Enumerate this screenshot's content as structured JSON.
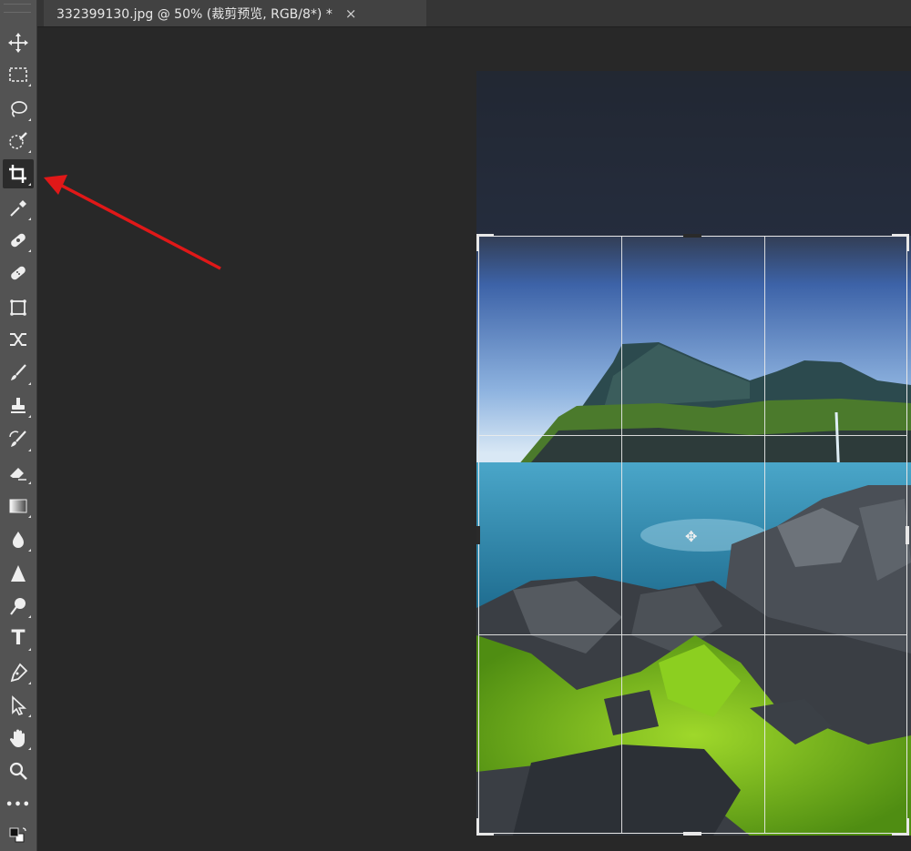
{
  "document_tab": {
    "title": "332399130.jpg @ 50% (裁剪预览, RGB/8*) *",
    "close_glyph": "×"
  },
  "toolbar": {
    "tools": [
      {
        "name": "move-tool",
        "icon": "move-icon",
        "active": false
      },
      {
        "name": "marquee-tool",
        "icon": "rectangular-marquee-icon",
        "active": false
      },
      {
        "name": "lasso-tool",
        "icon": "lasso-icon",
        "active": false
      },
      {
        "name": "quick-selection-tool",
        "icon": "quick-selection-icon",
        "active": false
      },
      {
        "name": "crop-tool",
        "icon": "crop-icon",
        "active": true
      },
      {
        "name": "eyedropper-tool",
        "icon": "eyedropper-icon",
        "active": false
      },
      {
        "name": "spot-healing-tool",
        "icon": "spot-healing-icon",
        "active": false
      },
      {
        "name": "healing-brush-tool",
        "icon": "bandage-icon",
        "active": false
      },
      {
        "name": "patch-tool",
        "icon": "patch-icon",
        "active": false
      },
      {
        "name": "content-aware-move-tool",
        "icon": "content-aware-move-icon",
        "active": false
      },
      {
        "name": "brush-tool",
        "icon": "brush-icon",
        "active": false
      },
      {
        "name": "clone-stamp-tool",
        "icon": "stamp-icon",
        "active": false
      },
      {
        "name": "history-brush-tool",
        "icon": "history-brush-icon",
        "active": false
      },
      {
        "name": "eraser-tool",
        "icon": "eraser-icon",
        "active": false
      },
      {
        "name": "gradient-tool",
        "icon": "gradient-icon",
        "active": false
      },
      {
        "name": "blur-tool",
        "icon": "blur-drop-icon",
        "active": false
      },
      {
        "name": "sharpen-tool",
        "icon": "sharpen-icon",
        "active": false
      },
      {
        "name": "dodge-tool",
        "icon": "dodge-icon",
        "active": false
      },
      {
        "name": "type-tool",
        "icon": "type-icon",
        "active": false,
        "glyph": "T"
      },
      {
        "name": "pen-tool",
        "icon": "pen-icon",
        "active": false
      },
      {
        "name": "path-selection-tool",
        "icon": "arrow-select-icon",
        "active": false
      },
      {
        "name": "hand-tool",
        "icon": "hand-icon",
        "active": false
      },
      {
        "name": "zoom-tool",
        "icon": "zoom-icon",
        "active": false
      },
      {
        "name": "more-tools",
        "icon": "ellipsis-icon",
        "active": false,
        "glyph": "•••"
      }
    ]
  },
  "annotation": {
    "type": "arrow",
    "color": "#e01818",
    "points_to": "crop-tool"
  },
  "colors": {
    "panel": "#535353",
    "canvas": "#282828",
    "tab": "#424242",
    "arrow": "#e01818"
  }
}
